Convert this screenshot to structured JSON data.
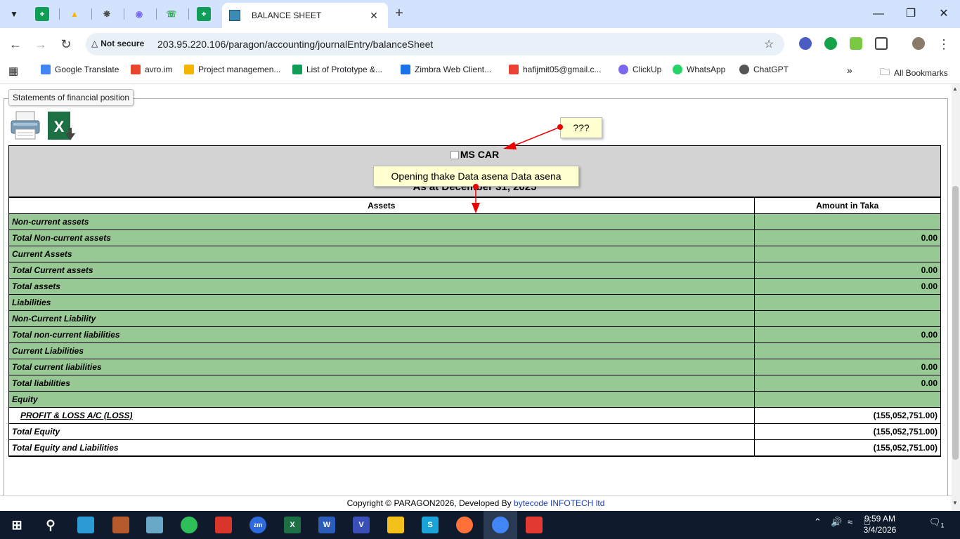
{
  "browser": {
    "tab_title": "BALANCE SHEET",
    "security_label": "Not secure",
    "url": "203.95.220.106/paragon/accounting/journalEntry/balanceSheet",
    "bookmarks": [
      {
        "label": "Google Translate",
        "color": "#4285f4"
      },
      {
        "label": "avro.im",
        "color": "#e8452c"
      },
      {
        "label": "Project managemen...",
        "color": "#f4b400"
      },
      {
        "label": "List of Prototype &...",
        "color": "#0f9d58"
      },
      {
        "label": "Zimbra Web Client...",
        "color": "#1a73e8"
      },
      {
        "label": "hafijmit05@gmail.c...",
        "color": "#ea4335"
      },
      {
        "label": "ClickUp",
        "color": "#7b68ee"
      },
      {
        "label": "WhatsApp",
        "color": "#25d366"
      },
      {
        "label": "ChatGPT",
        "color": "#555555"
      }
    ],
    "all_bookmarks": "All Bookmarks"
  },
  "page": {
    "tooltip_title": "Statements of financial position",
    "company": "MS CAR",
    "as_at": "As at December 31, 2025",
    "col_assets": "Assets",
    "col_amount": "Amount in Taka",
    "rows": [
      {
        "label": "Non-current assets",
        "amount": "",
        "green": true,
        "italic": true
      },
      {
        "label": "Total Non-current assets",
        "amount": "0.00",
        "green": true
      },
      {
        "label": "Current Assets",
        "amount": "",
        "green": true,
        "italic": true
      },
      {
        "label": "Total Current assets",
        "amount": "0.00",
        "green": true
      },
      {
        "label": "Total assets",
        "amount": "0.00",
        "green": true
      },
      {
        "label": "Liabilities",
        "amount": "",
        "green": true,
        "italic": true
      },
      {
        "label": "Non-Current Liability",
        "amount": "",
        "green": true,
        "italic": true
      },
      {
        "label": "Total non-current liabilities",
        "amount": "0.00",
        "green": true
      },
      {
        "label": "Current Liabilities",
        "amount": "",
        "green": true,
        "italic": true
      },
      {
        "label": "Total current liabilities",
        "amount": "0.00",
        "green": true
      },
      {
        "label": "Total liabilities",
        "amount": "0.00",
        "green": true
      },
      {
        "label": "Equity",
        "amount": "",
        "green": true,
        "italic": true
      },
      {
        "label": "PROFIT & LOSS A/C (LOSS)",
        "amount": "(155,052,751.00)",
        "pl": true
      },
      {
        "label": "Total Equity",
        "amount": "(155,052,751.00)"
      },
      {
        "label": "Total Equity and Liabilities",
        "amount": "(155,052,751.00)"
      }
    ],
    "annotation_top": "???",
    "annotation_mid": "Opening thake Data asena Data asena",
    "footer_text": "Copyright © PARAGON2026, Developed By ",
    "footer_link": "bytecode INFOTECH ltd"
  },
  "taskbar": {
    "time": "9:59 AM",
    "date": "3/4/2026",
    "notification_count": "1"
  }
}
